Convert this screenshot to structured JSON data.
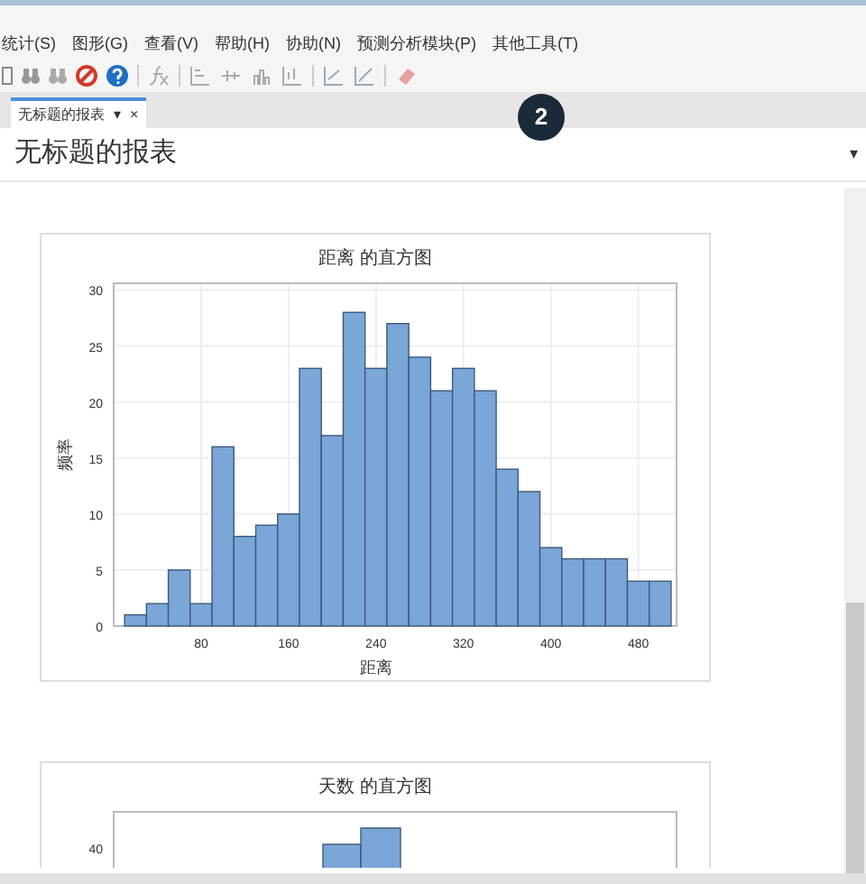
{
  "menu": [
    "统计(S)",
    "图形(G)",
    "查看(V)",
    "帮助(H)",
    "协助(N)",
    "预测分析模块(P)",
    "其他工具(T)"
  ],
  "tabs": [
    {
      "label": "无标题的报表",
      "dropdown": "▾",
      "close": "×",
      "selected": true
    }
  ],
  "step_badge": "2",
  "report": {
    "title": "无标题的报表",
    "menu_caret": "▾"
  },
  "chart": {
    "chart_data": {
      "type": "bar",
      "title": "距离 的直方图",
      "xlabel": "距离",
      "ylabel": "频率",
      "x": [
        20,
        40,
        60,
        80,
        100,
        120,
        140,
        160,
        180,
        200,
        220,
        240,
        260,
        280,
        300,
        320,
        340,
        360,
        380,
        400,
        420,
        440,
        460,
        480,
        500
      ],
      "grid": true,
      "series": [
        {
          "color": "#7aa6d8",
          "values": [
            1,
            2,
            5,
            2,
            16,
            8,
            9,
            10,
            23,
            17,
            28,
            23,
            27,
            24,
            21,
            23,
            21,
            14,
            12,
            7,
            6,
            6,
            6,
            4,
            4
          ]
        }
      ],
      "xlim": [
        0,
        515
      ],
      "ylim": [
        0,
        30.6
      ],
      "xticks": [
        80,
        160,
        240,
        320,
        400,
        480
      ],
      "yticks": [
        0,
        5,
        10,
        15,
        20,
        25,
        30
      ]
    }
  },
  "chart_2": {
    "title": "天数 的直方图",
    "ytick": "40"
  }
}
